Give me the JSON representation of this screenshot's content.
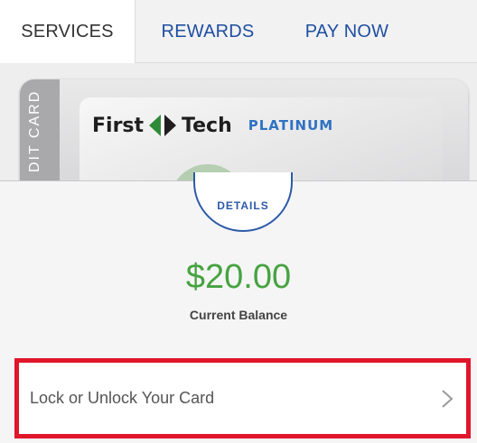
{
  "tabs": [
    {
      "label": "SERVICES",
      "active": true
    },
    {
      "label": "REWARDS",
      "active": false
    },
    {
      "label": "PAY NOW",
      "active": false
    }
  ],
  "card": {
    "strip_text": "DIT CARD",
    "brand_left": "First",
    "brand_right": "Tech",
    "tier": "PLATINUM"
  },
  "details": {
    "label": "DETAILS",
    "balance": "$20.00",
    "balance_label": "Current Balance"
  },
  "actions": {
    "lock_label": "Lock or Unlock Your Card"
  },
  "colors": {
    "tab_link": "#1f4fa0",
    "balance": "#47a341",
    "highlight": "#e0162b",
    "details_ring": "#2c5aa8"
  },
  "icons": {
    "brand_mark": "first-tech-logo-icon",
    "chevron": "chevron-right-icon"
  }
}
